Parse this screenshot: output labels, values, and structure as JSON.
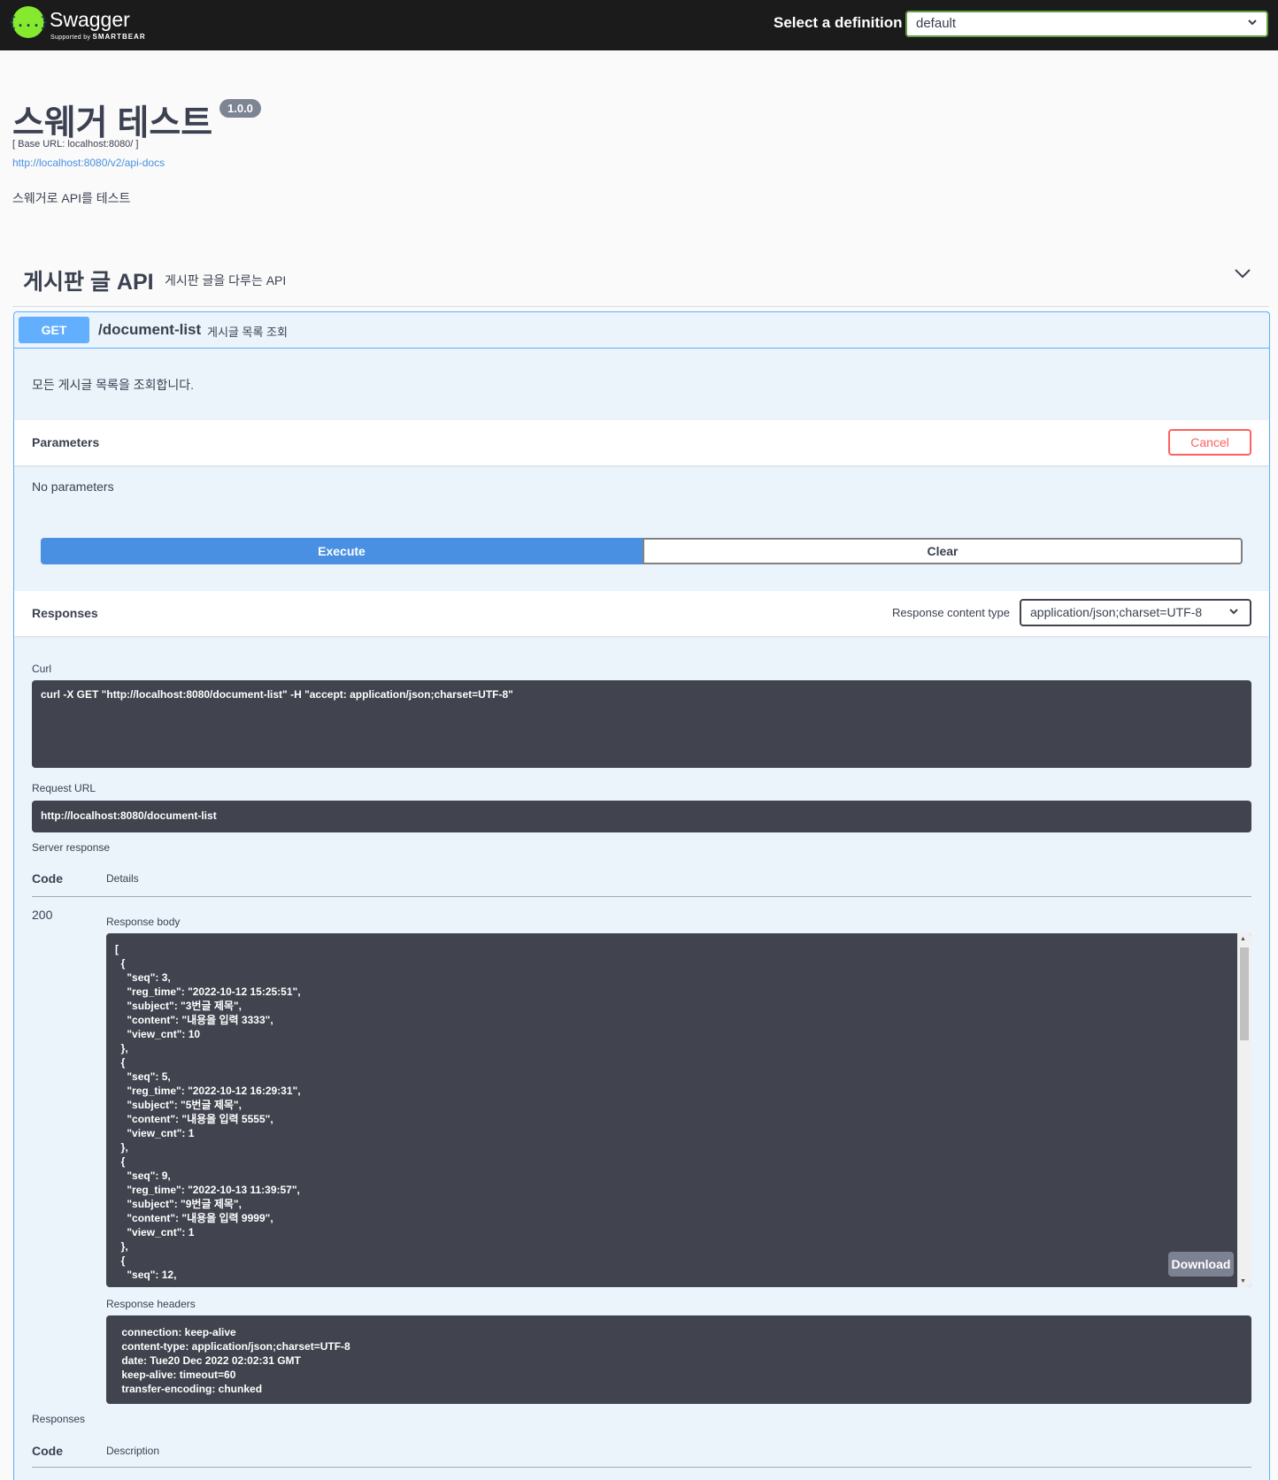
{
  "topbar": {
    "logo_glyph": "{...}",
    "brand": "Swagger",
    "brand_sub_prefix": "Supported by",
    "brand_sub_name": "SMARTBEAR",
    "definition_label": "Select a definition",
    "definition_value": "default"
  },
  "info": {
    "title": "스웨거 테스트",
    "version": "1.0.0",
    "base_url": "[ Base URL: localhost:8080/ ]",
    "api_docs_link": "http://localhost:8080/v2/api-docs",
    "description": "스웨거로 API를 테스트"
  },
  "tag": {
    "name": "게시판 글 API",
    "description": "게시판 글을 다루는 API"
  },
  "operation": {
    "method": "GET",
    "path": "/document-list",
    "summary": "게시글 목록 조회",
    "description": "모든 게시글 목록을 조회합니다.",
    "parameters_label": "Parameters",
    "cancel_label": "Cancel",
    "no_parameters": "No parameters",
    "execute_label": "Execute",
    "clear_label": "Clear",
    "responses_label": "Responses",
    "response_content_type_label": "Response content type",
    "response_content_type_value": "application/json;charset=UTF-8",
    "curl_label": "Curl",
    "curl_command": "curl -X GET \"http://localhost:8080/document-list\" -H \"accept: application/json;charset=UTF-8\"",
    "request_url_label": "Request URL",
    "request_url": "http://localhost:8080/document-list",
    "server_response_label": "Server response",
    "code_header": "Code",
    "details_header": "Details",
    "response_code": "200",
    "response_body_label": "Response body",
    "response_body": "[\n  {\n    \"seq\": 3,\n    \"reg_time\": \"2022-10-12 15:25:51\",\n    \"subject\": \"3번글 제목\",\n    \"content\": \"내용을 입력 3333\",\n    \"view_cnt\": 10\n  },\n  {\n    \"seq\": 5,\n    \"reg_time\": \"2022-10-12 16:29:31\",\n    \"subject\": \"5번글 제목\",\n    \"content\": \"내용을 입력 5555\",\n    \"view_cnt\": 1\n  },\n  {\n    \"seq\": 9,\n    \"reg_time\": \"2022-10-13 11:39:57\",\n    \"subject\": \"9번글 제목\",\n    \"content\": \"내용을 입력 9999\",\n    \"view_cnt\": 1\n  },\n  {\n    \"seq\": 12,",
    "download_label": "Download",
    "response_headers_label": "Response headers",
    "response_headers": " connection: keep-alive \n content-type: application/json;charset=UTF-8 \n date: Tue20 Dec 2022 02:02:31 GMT \n keep-alive: timeout=60 \n transfer-encoding: chunked ",
    "responses_footer_label": "Responses",
    "footer_code_header": "Code",
    "footer_description_header": "Description"
  }
}
